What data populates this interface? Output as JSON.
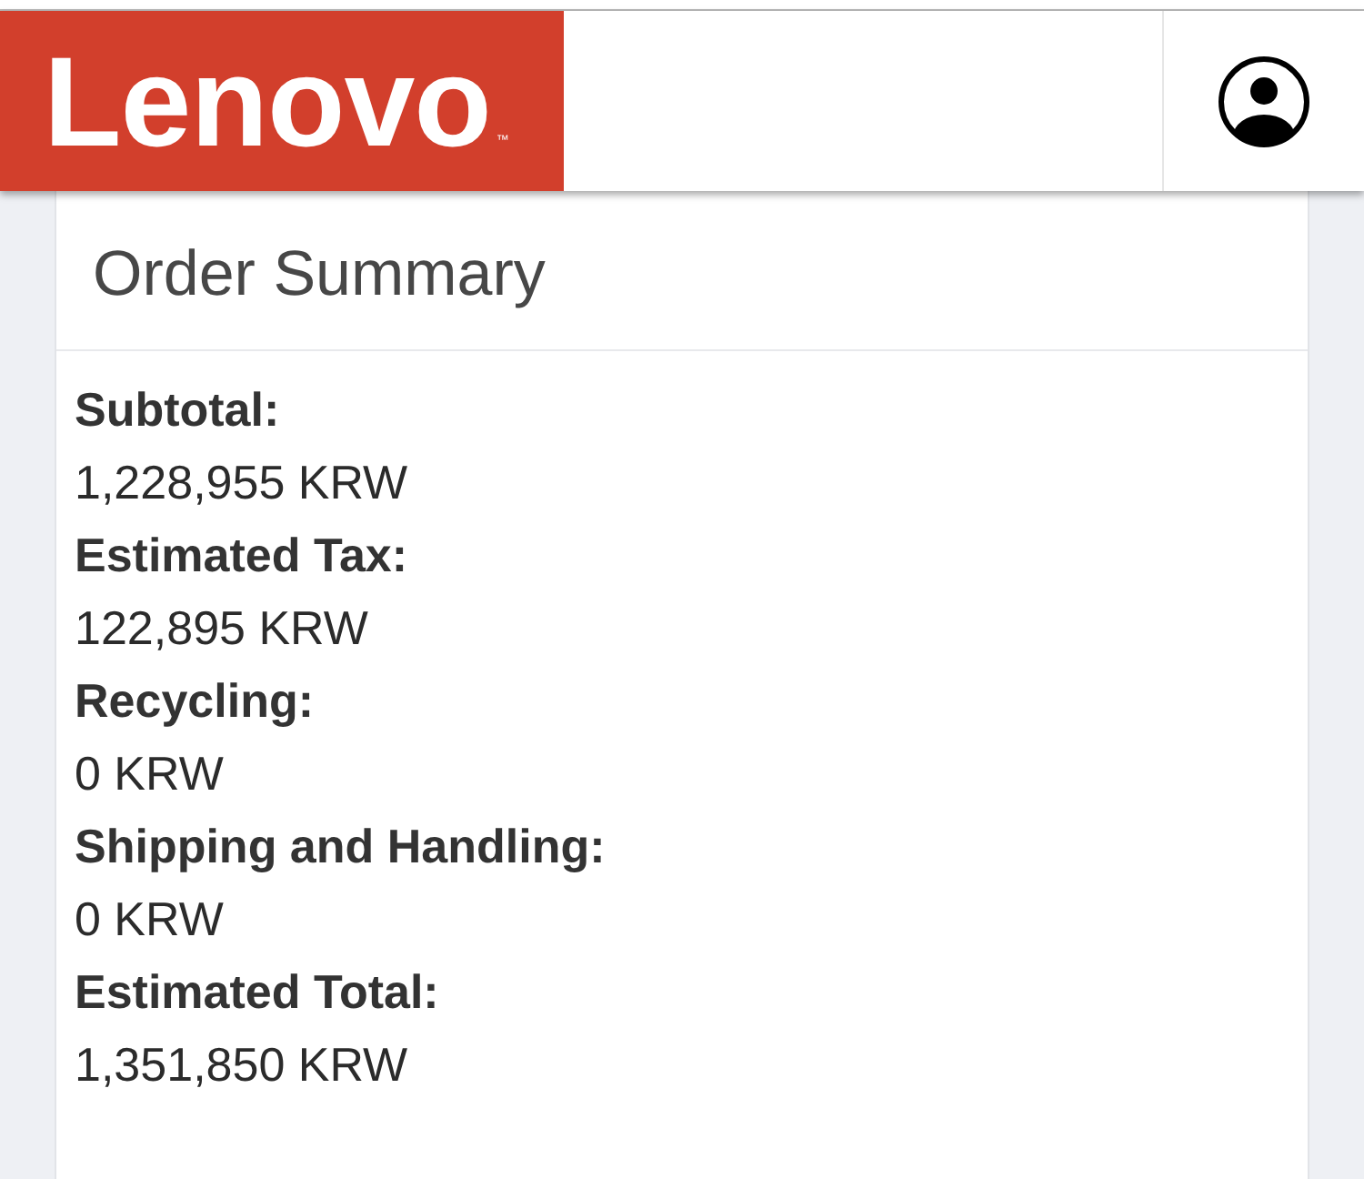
{
  "header": {
    "logo": {
      "text": "Lenovo",
      "mark": "™"
    }
  },
  "order_summary": {
    "title": "Order Summary",
    "lines": [
      {
        "label": "Subtotal:",
        "value": "1,228,955 KRW"
      },
      {
        "label": "Estimated Tax:",
        "value": "122,895 KRW"
      },
      {
        "label": "Recycling:",
        "value": "0 KRW"
      },
      {
        "label": "Shipping and Handling:",
        "value": "0 KRW"
      },
      {
        "label": "Estimated Total:",
        "value": "1,351,850 KRW"
      }
    ]
  }
}
